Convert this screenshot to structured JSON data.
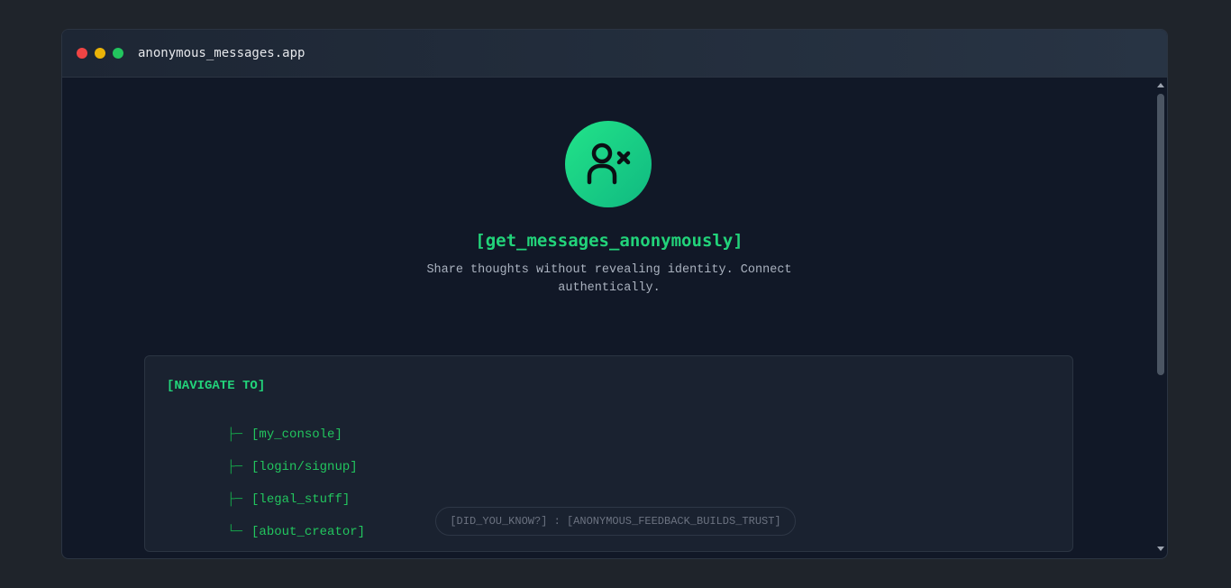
{
  "window": {
    "title": "anonymous_messages.app"
  },
  "hero": {
    "icon": "user-x-icon",
    "title": "[get_messages_anonymously]",
    "subtitle": "Share thoughts without revealing identity. Connect authentically."
  },
  "nav": {
    "heading": "[NAVIGATE TO]",
    "items": [
      {
        "branch": "├─",
        "label": "[my_console]"
      },
      {
        "branch": "├─",
        "label": "[login/signup]"
      },
      {
        "branch": "├─",
        "label": "[legal_stuff]"
      },
      {
        "branch": "└─",
        "label": "[about_creator]"
      }
    ]
  },
  "tip": {
    "text": "[DID_YOU_KNOW?] : [ANONYMOUS_FEEDBACK_BUILDS_TRUST]"
  },
  "colors": {
    "accent": "#22d37a",
    "background": "#111827",
    "card": "#1a2230"
  }
}
